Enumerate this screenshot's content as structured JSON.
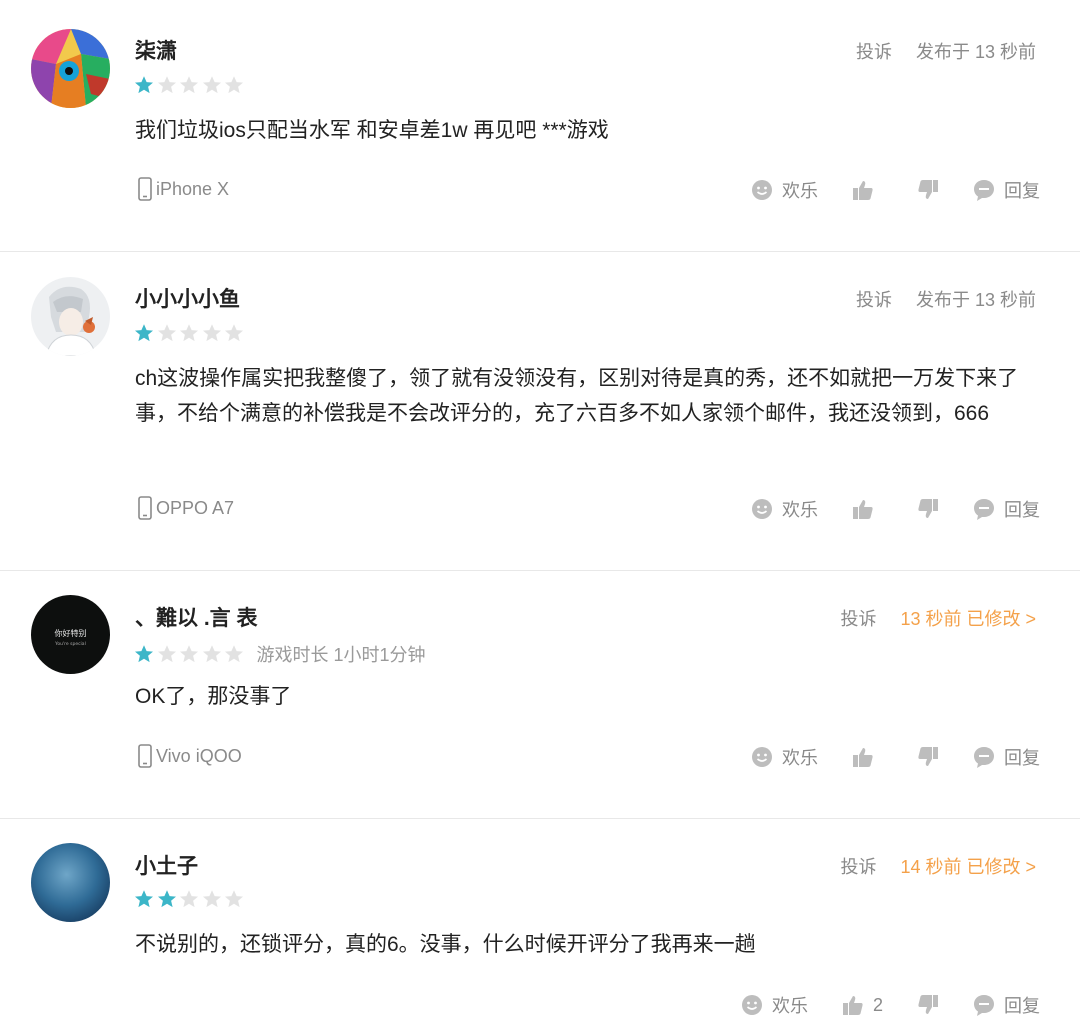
{
  "colors": {
    "star_filled": "#3cb6c8",
    "star_empty": "#e2e2e2",
    "edited": "#f4a14a",
    "meta": "#8a8a8a"
  },
  "reviews": [
    {
      "name": "柒潇",
      "rating": 1,
      "playtime": "",
      "report": "投诉",
      "time": "发布于 13 秒前",
      "edited": false,
      "text": "我们垃圾ios只配当水军 和安卓差1w 再见吧 ***游戏",
      "device": "iPhone X",
      "fun": "欢乐",
      "likes": "",
      "reply": "回复",
      "avatar": "lion-art-avatar"
    },
    {
      "name": "小小小小鱼",
      "rating": 1,
      "playtime": "",
      "report": "投诉",
      "time": "发布于 13 秒前",
      "edited": false,
      "text": "ch这波操作属实把我整傻了，领了就有没领没有，区别对待是真的秀，还不如就把一万发下来了事，不给个满意的补偿我是不会改评分的，充了六百多不如人家领个邮件，我还没领到，666",
      "device": "OPPO A7",
      "fun": "欢乐",
      "likes": "",
      "reply": "回复",
      "avatar": "anime-boy-avatar"
    },
    {
      "name": "、難以 .言 表",
      "rating": 1,
      "playtime": "游戏时长 1小时1分钟",
      "report": "投诉",
      "time": "13 秒前 已修改 >",
      "edited": true,
      "text": "OK了，那没事了",
      "device": "Vivo iQOO",
      "fun": "欢乐",
      "likes": "",
      "reply": "回复",
      "avatar": "black-text-avatar",
      "avatar_text": "你好特别",
      "avatar_subtext": "You're special"
    },
    {
      "name": "小土子",
      "rating": 2,
      "playtime": "",
      "report": "投诉",
      "time": "14 秒前 已修改 >",
      "edited": true,
      "text": "不说别的，还锁评分，真的6。没事，什么时候开评分了我再来一趟",
      "device": "",
      "fun": "欢乐",
      "likes": "2",
      "reply": "回复",
      "avatar": "blue-sky-avatar"
    }
  ]
}
